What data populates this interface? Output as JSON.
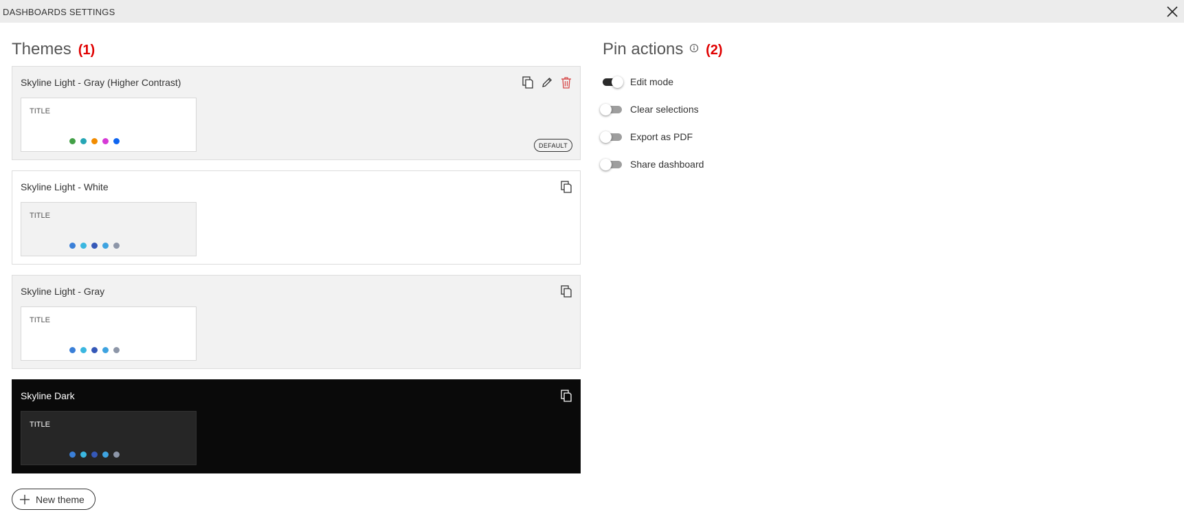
{
  "window": {
    "title": "DASHBOARDS SETTINGS"
  },
  "themes_section": {
    "title": "Themes",
    "marker": "(1)"
  },
  "pin_section": {
    "title": "Pin actions",
    "marker": "(2)"
  },
  "themes": [
    {
      "name": "Skyline Light - Gray (Higher Contrast)",
      "preview_title": "TITLE",
      "default_badge": "DEFAULT",
      "card_bg": "#f2f2f2",
      "preview_bg": "#ffffff",
      "dots": [
        "#43a047",
        "#26a6b5",
        "#f28c00",
        "#d63ad6",
        "#0e65f0"
      ],
      "actions": [
        "copy-icon",
        "edit-icon",
        "delete-icon"
      ]
    },
    {
      "name": "Skyline Light - White",
      "preview_title": "TITLE",
      "card_bg": "#ffffff",
      "preview_bg": "#f2f2f2",
      "dots": [
        "#3a7fd8",
        "#3ab7e0",
        "#3558b8",
        "#3ea3e0",
        "#8d96a8"
      ],
      "actions": [
        "copy-icon"
      ]
    },
    {
      "name": "Skyline Light - Gray",
      "preview_title": "TITLE",
      "card_bg": "#f2f2f2",
      "preview_bg": "#ffffff",
      "dots": [
        "#3a7fd8",
        "#3ab7e0",
        "#3558b8",
        "#3ea3e0",
        "#8d96a8"
      ],
      "actions": [
        "copy-icon"
      ]
    },
    {
      "name": "Skyline Dark",
      "preview_title": "TITLE",
      "card_bg": "#0a0a0a",
      "preview_bg": "#262626",
      "dots": [
        "#3a7fd8",
        "#3ab7e0",
        "#3558b8",
        "#3ea3e0",
        "#8d96a8"
      ],
      "actions": [
        "copy-icon"
      ]
    }
  ],
  "new_theme_button": {
    "label": "New theme"
  },
  "pin_actions": [
    {
      "label": "Edit mode",
      "on": true
    },
    {
      "label": "Clear selections",
      "on": false
    },
    {
      "label": "Export as PDF",
      "on": false
    },
    {
      "label": "Share dashboard",
      "on": false
    }
  ],
  "colors": {
    "accent_red": "#e00000",
    "delete_red": "#d64545",
    "toggle_on": "#2b2b2b",
    "toggle_off": "#9e9e9e"
  }
}
